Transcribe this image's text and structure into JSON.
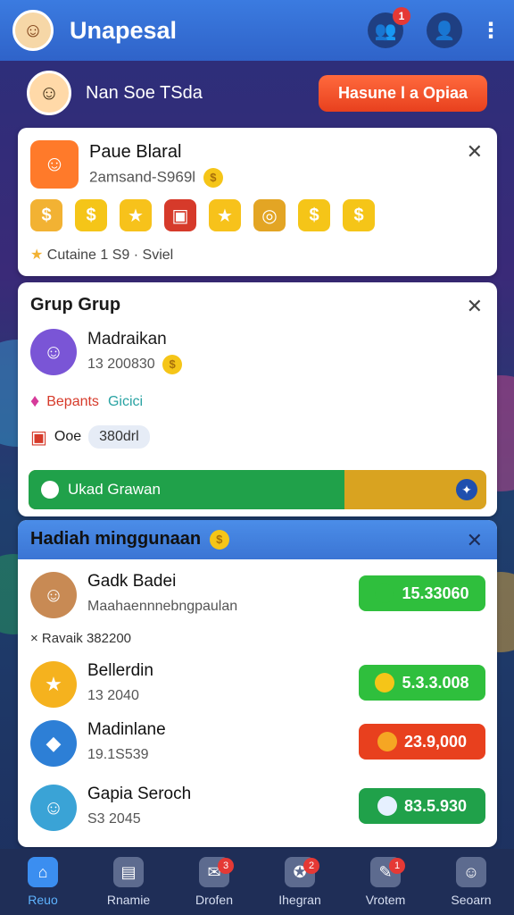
{
  "header": {
    "title": "Unapesal",
    "friends_badge": "1",
    "avatar_glyph": "☺",
    "friends_icon": "people-icon",
    "profile_icon": "profile-icon",
    "menu_icon": "more-vertical-icon"
  },
  "player": {
    "name": "Nan Soe TSda",
    "cta_label": "Hasune l a Opiaa",
    "avatar_glyph": "☺"
  },
  "card_top": {
    "title": "Paue Blaral",
    "subtitle": "2amsand-S969l",
    "footer": "Cutaine 1 S9 · Sviel",
    "avatar_glyph": "☺",
    "reward_icons": [
      "coin-bag-icon",
      "coin-icon",
      "star-icon",
      "chest-icon",
      "star-icon",
      "ring-icon",
      "coin-icon",
      "coin-icon"
    ]
  },
  "group": {
    "title": "Grup Grup",
    "user_name": "Madraikan",
    "user_value": "13 200830",
    "tag_red": "Bepants",
    "tag_teal": "Gicici",
    "chest_label": "Ooe",
    "chest_value": "380drl",
    "progress_label": "Ukad Grawan",
    "progress_fraction": 0.69,
    "avatar_glyph": "☺"
  },
  "weekly": {
    "title": "Hadiah minggunaan",
    "rows": [
      {
        "name": "Gadk Badei",
        "sub": "Maahaennnebngpaulan",
        "amount": "15.33060",
        "color": "#2fbf3d",
        "icon_color": "#2fbf3d",
        "avatar_color": "#c88a54",
        "avatar_glyph": "☺"
      },
      {
        "name": "Bellerdin",
        "sub": "13 2040",
        "amount": "5.3.3.008",
        "color": "#2fbf3d",
        "icon_color": "#f5c518",
        "avatar_color": "#f5b21e",
        "avatar_glyph": "★"
      },
      {
        "name": "Madinlane",
        "sub": "19.1S539",
        "amount": "23.9,000",
        "color": "#e8401e",
        "icon_color": "#f5a623",
        "avatar_color": "#2d7fd6",
        "avatar_glyph": "◆"
      },
      {
        "name": "Gapia Seroch",
        "sub": "S3 2045",
        "amount": "83.5.930",
        "color": "#20a14a",
        "icon_color": "#e6f0ff",
        "avatar_color": "#3aa3d6",
        "avatar_glyph": "☺"
      }
    ],
    "extra": "× Ravaik  382200"
  },
  "nav": [
    {
      "label": "Reuo",
      "icon": "home-icon",
      "badge": "",
      "active": true
    },
    {
      "label": "Rnamie",
      "icon": "cards-icon",
      "badge": "",
      "active": false
    },
    {
      "label": "Drofen",
      "icon": "gift-icon",
      "badge": "3",
      "active": false
    },
    {
      "label": "Ihegran",
      "icon": "trophy-icon",
      "badge": "2",
      "active": false
    },
    {
      "label": "Vrotem",
      "icon": "chat-icon",
      "badge": "1",
      "active": false
    },
    {
      "label": "Seoarn",
      "icon": "user-icon",
      "badge": "",
      "active": false
    }
  ]
}
